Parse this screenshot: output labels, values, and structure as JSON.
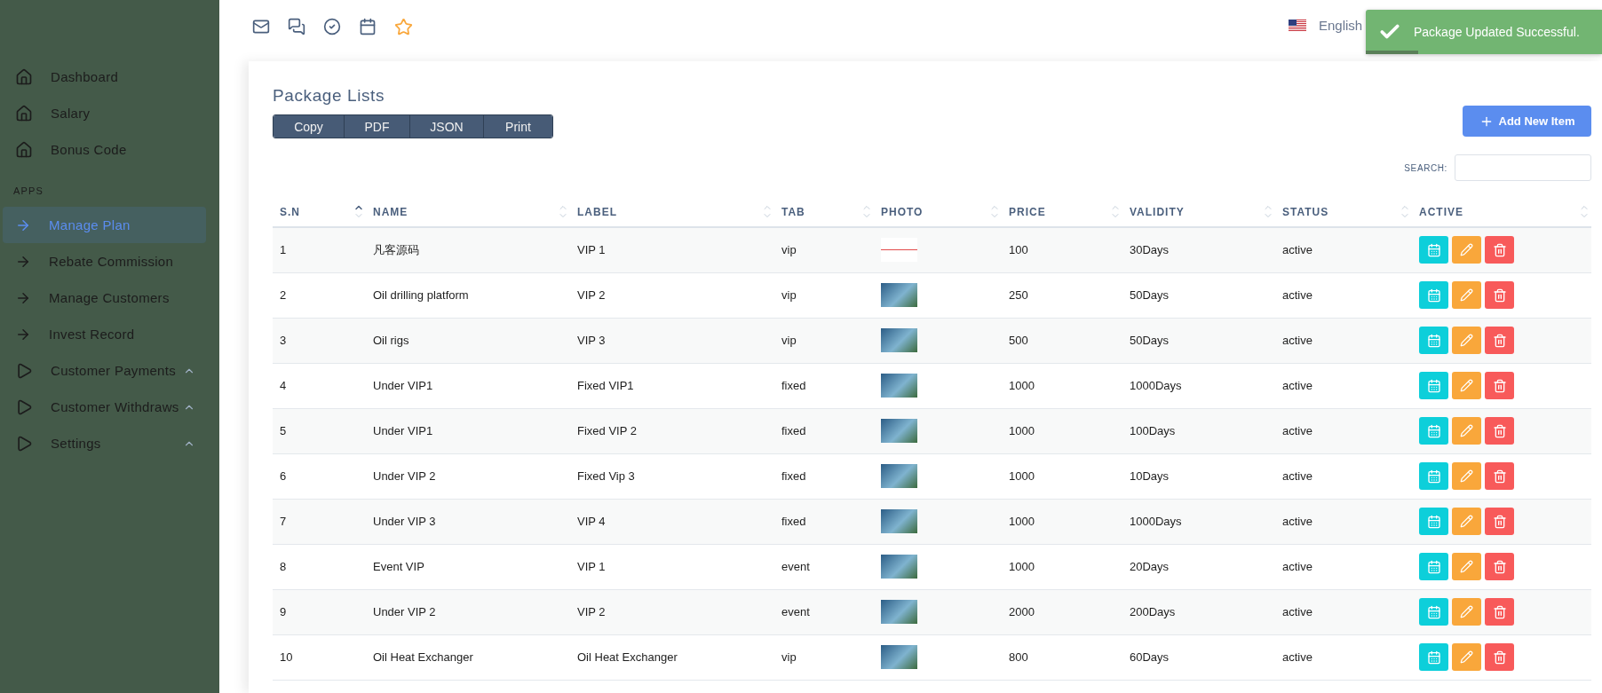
{
  "sidebar": {
    "items": [
      {
        "label": "Dashboard",
        "kind": "home",
        "selected": false
      },
      {
        "label": "Salary",
        "kind": "home",
        "selected": false
      },
      {
        "label": "Bonus Code",
        "kind": "home",
        "selected": false
      }
    ],
    "section": "APPS",
    "apps": [
      {
        "label": "Manage Plan",
        "kind": "link",
        "selected": true,
        "expandable": false
      },
      {
        "label": "Rebate Commission",
        "kind": "link",
        "selected": false,
        "expandable": false
      },
      {
        "label": "Manage Customers",
        "kind": "link",
        "selected": false,
        "expandable": false
      },
      {
        "label": "Invest Record",
        "kind": "link",
        "selected": false,
        "expandable": false
      },
      {
        "label": "Customer Payments",
        "kind": "group",
        "selected": false,
        "expandable": true
      },
      {
        "label": "Customer Withdraws",
        "kind": "group",
        "selected": false,
        "expandable": true
      },
      {
        "label": "Settings",
        "kind": "group",
        "selected": false,
        "expandable": true
      }
    ]
  },
  "topbar": {
    "language": "English"
  },
  "toast": {
    "message": "Package Updated Successful.",
    "level": 0.22
  },
  "card": {
    "title": "Package Lists",
    "export_buttons": [
      "Copy",
      "PDF",
      "JSON",
      "Print"
    ],
    "add_button": "Add New Item",
    "search_label": "SEARCH:"
  },
  "table": {
    "columns": [
      {
        "label": "S.N",
        "sorted": true
      },
      {
        "label": "NAME",
        "sorted": false
      },
      {
        "label": "LABEL",
        "sorted": false
      },
      {
        "label": "TAB",
        "sorted": false
      },
      {
        "label": "PHOTO",
        "sorted": false
      },
      {
        "label": "PRICE",
        "sorted": false
      },
      {
        "label": "VALIDITY",
        "sorted": false
      },
      {
        "label": "STATUS",
        "sorted": false
      },
      {
        "label": "ACTIVE",
        "sorted": false
      }
    ],
    "rows": [
      {
        "sn": "1",
        "name": "凡客源码",
        "label": "VIP 1",
        "tab": "vip",
        "price": "100",
        "validity": "30Days",
        "status": "active"
      },
      {
        "sn": "2",
        "name": "Oil drilling platform",
        "label": "VIP 2",
        "tab": "vip",
        "price": "250",
        "validity": "50Days",
        "status": "active"
      },
      {
        "sn": "3",
        "name": "Oil rigs",
        "label": "VIP 3",
        "tab": "vip",
        "price": "500",
        "validity": "50Days",
        "status": "active"
      },
      {
        "sn": "4",
        "name": "Under VIP1",
        "label": "Fixed VIP1",
        "tab": "fixed",
        "price": "1000",
        "validity": "1000Days",
        "status": "active"
      },
      {
        "sn": "5",
        "name": "Under VIP1",
        "label": "Fixed VIP 2",
        "tab": "fixed",
        "price": "1000",
        "validity": "100Days",
        "status": "active"
      },
      {
        "sn": "6",
        "name": "Under VIP 2",
        "label": "Fixed Vip 3",
        "tab": "fixed",
        "price": "1000",
        "validity": "10Days",
        "status": "active"
      },
      {
        "sn": "7",
        "name": "Under VIP 3",
        "label": "VIP 4",
        "tab": "fixed",
        "price": "1000",
        "validity": "1000Days",
        "status": "active"
      },
      {
        "sn": "8",
        "name": "Event VIP",
        "label": "VIP 1",
        "tab": "event",
        "price": "1000",
        "validity": "20Days",
        "status": "active"
      },
      {
        "sn": "9",
        "name": "Under VIP 2",
        "label": "VIP 2",
        "tab": "event",
        "price": "2000",
        "validity": "200Days",
        "status": "active"
      },
      {
        "sn": "10",
        "name": "Oil Heat Exchanger",
        "label": "Oil Heat Exchanger",
        "tab": "vip",
        "price": "800",
        "validity": "60Days",
        "status": "active"
      }
    ]
  }
}
